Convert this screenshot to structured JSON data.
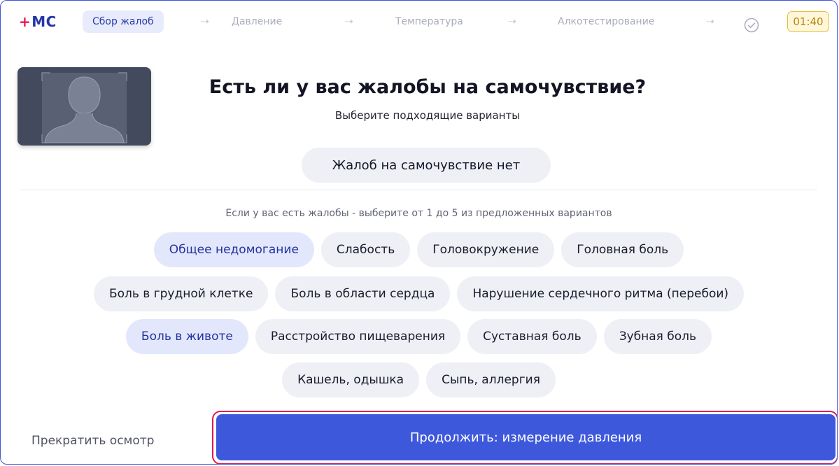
{
  "header": {
    "logo_plus": "+",
    "logo_text": "МС",
    "steps": [
      {
        "label": "Сбор жалоб",
        "active": true
      },
      {
        "label": "Давление",
        "active": false
      },
      {
        "label": "Температура",
        "active": false
      },
      {
        "label": "Алкотестирование",
        "active": false
      }
    ],
    "arrow_glyph": "⇢",
    "timer": "01:40"
  },
  "camera": {
    "icon": "person-silhouette-icon"
  },
  "question": {
    "title": "Есть ли у вас жалобы на самочувствие?",
    "subtitle": "Выберите подходящие варианты",
    "no_complaints": "Жалоб на самочувствие нет"
  },
  "hint": "Если у вас есть жалобы - выберите от 1 до 5 из предложенных вариантов",
  "chip_rows": [
    [
      {
        "label": "Общее недомогание",
        "selected": true
      },
      {
        "label": "Слабость",
        "selected": false
      },
      {
        "label": "Головокружение",
        "selected": false
      },
      {
        "label": "Головная боль",
        "selected": false
      }
    ],
    [
      {
        "label": "Боль в грудной клетке",
        "selected": false
      },
      {
        "label": "Боль в области сердца",
        "selected": false
      },
      {
        "label": "Нарушение сердечного ритма (перебои)",
        "selected": false
      }
    ],
    [
      {
        "label": "Боль в животе",
        "selected": true
      },
      {
        "label": "Расстройство пищеварения",
        "selected": false
      },
      {
        "label": "Суставная боль",
        "selected": false
      },
      {
        "label": "Зубная боль",
        "selected": false
      }
    ],
    [
      {
        "label": "Кашель, одышка",
        "selected": false
      },
      {
        "label": "Сыпь, аллергия",
        "selected": false
      }
    ]
  ],
  "footer": {
    "stop_label": "Прекратить осмотр",
    "continue_label": "Продолжить: измерение давления"
  },
  "colors": {
    "accent": "#3e58dc",
    "brand_red": "#e8194f",
    "selected_chip_bg": "#e3e7fb",
    "chip_bg": "#eef0f6",
    "timer_bg": "#fff7d9",
    "timer_border": "#e8be3b"
  }
}
